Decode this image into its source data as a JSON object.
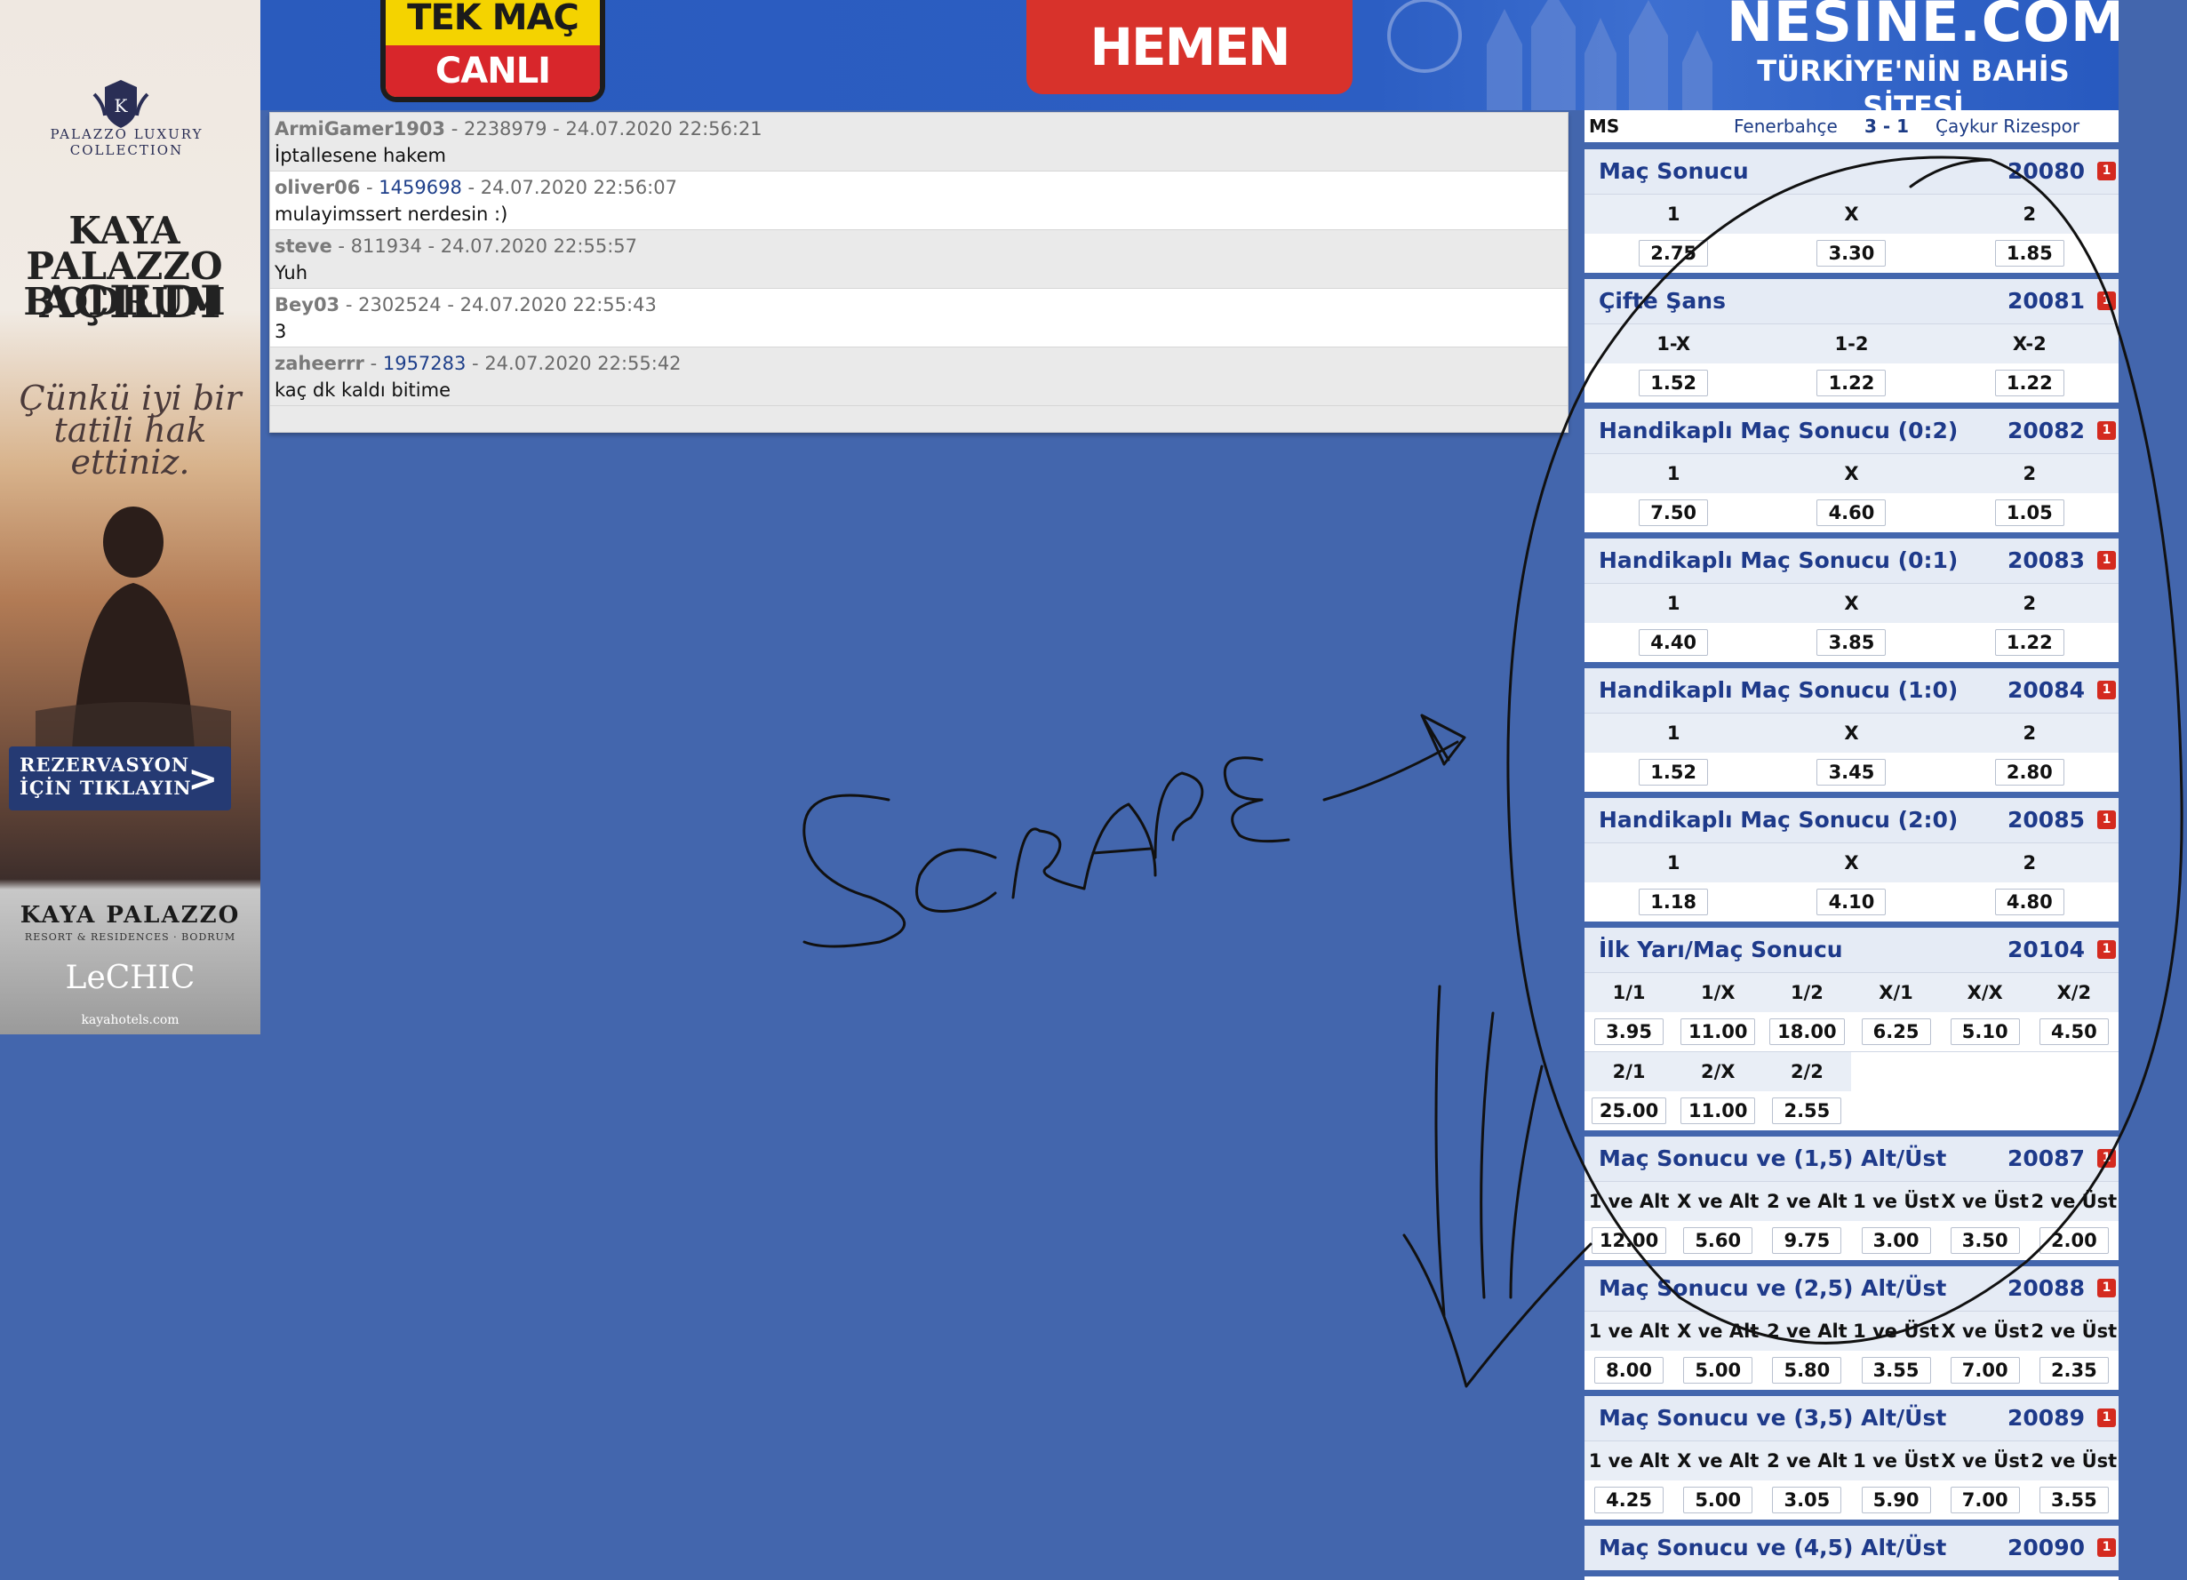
{
  "banner": {
    "tekmac_top": "TEK MAÇ",
    "tekmac_bottom": "CANLI İDDAA",
    "cta": "HEMEN OYNA",
    "site_name": "NESINE.COM",
    "site_tagline": "TÜRKİYE'NİN BAHİS SİTESİ"
  },
  "left_ad": {
    "collection": "PALAZZO LUXURY COLLECTION",
    "title_line1": "KAYA PALAZZO BODRUM",
    "title_line2": "AÇILDI",
    "slogan": "Çünkü iyi bir tatili hak ettiniz.",
    "cta": "REZERVASYON İÇİN TIKLAYIN",
    "cta_arrow": ">",
    "brand": "KAYA PALAZZO",
    "brand_sub": "RESORT & RESIDENCES · BODRUM",
    "lechic": "LeCHIC",
    "site": "kayahotels.com"
  },
  "comments": [
    {
      "user": "ArmiGamer1903",
      "id": "2238979",
      "id_link": false,
      "time": "24.07.2020 22:56:21",
      "text": "İptallesene hakem"
    },
    {
      "user": "oliver06",
      "id": "1459698",
      "id_link": true,
      "time": "24.07.2020 22:56:07",
      "text": "mulayimssert nerdesin :)"
    },
    {
      "user": "steve",
      "id": "811934",
      "id_link": false,
      "time": "24.07.2020 22:55:57",
      "text": "Yuh"
    },
    {
      "user": "Bey03",
      "id": "2302524",
      "id_link": false,
      "time": "24.07.2020 22:55:43",
      "text": "3"
    },
    {
      "user": "zaheerrr",
      "id": "1957283",
      "id_link": true,
      "time": "24.07.2020 22:55:42",
      "text": "kaç dk kaldı bitime"
    }
  ],
  "match": {
    "ms": "MS",
    "home": "Fenerbahçe",
    "score": "3 - 1",
    "away": "Çaykur Rizespor"
  },
  "markets": [
    {
      "title": "Maç Sonucu",
      "code": "20080",
      "badge": "1",
      "cols": 3,
      "rows": [
        {
          "labels": [
            "1",
            "X",
            "2"
          ],
          "odds": [
            "2.75",
            "3.30",
            "1.85"
          ]
        }
      ]
    },
    {
      "title": "Çifte Şans",
      "code": "20081",
      "badge": "1",
      "cols": 3,
      "rows": [
        {
          "labels": [
            "1-X",
            "1-2",
            "X-2"
          ],
          "odds": [
            "1.52",
            "1.22",
            "1.22"
          ]
        }
      ]
    },
    {
      "title": "Handikaplı Maç Sonucu (0:2)",
      "code": "20082",
      "badge": "1",
      "cols": 3,
      "rows": [
        {
          "labels": [
            "1",
            "X",
            "2"
          ],
          "odds": [
            "7.50",
            "4.60",
            "1.05"
          ]
        }
      ]
    },
    {
      "title": "Handikaplı Maç Sonucu (0:1)",
      "code": "20083",
      "badge": "1",
      "cols": 3,
      "rows": [
        {
          "labels": [
            "1",
            "X",
            "2"
          ],
          "odds": [
            "4.40",
            "3.85",
            "1.22"
          ]
        }
      ]
    },
    {
      "title": "Handikaplı Maç Sonucu (1:0)",
      "code": "20084",
      "badge": "1",
      "cols": 3,
      "rows": [
        {
          "labels": [
            "1",
            "X",
            "2"
          ],
          "odds": [
            "1.52",
            "3.45",
            "2.80"
          ]
        }
      ]
    },
    {
      "title": "Handikaplı Maç Sonucu (2:0)",
      "code": "20085",
      "badge": "1",
      "cols": 3,
      "rows": [
        {
          "labels": [
            "1",
            "X",
            "2"
          ],
          "odds": [
            "1.18",
            "4.10",
            "4.80"
          ]
        }
      ]
    },
    {
      "title": "İlk Yarı/Maç Sonucu",
      "code": "20104",
      "badge": "1",
      "cols": 6,
      "rows": [
        {
          "labels": [
            "1/1",
            "1/X",
            "1/2",
            "X/1",
            "X/X",
            "X/2"
          ],
          "odds": [
            "3.95",
            "11.00",
            "18.00",
            "6.25",
            "5.10",
            "4.50"
          ]
        },
        {
          "labels": [
            "2/1",
            "2/X",
            "2/2"
          ],
          "odds": [
            "25.00",
            "11.00",
            "2.55"
          ]
        }
      ]
    },
    {
      "title": "Maç Sonucu ve (1,5) Alt/Üst",
      "code": "20087",
      "badge": "1",
      "cols": 6,
      "rows": [
        {
          "labels": [
            "1 ve Alt",
            "X ve Alt",
            "2 ve Alt",
            "1 ve Üst",
            "X ve Üst",
            "2 ve Üst"
          ],
          "odds": [
            "12.00",
            "5.60",
            "9.75",
            "3.00",
            "3.50",
            "2.00"
          ]
        }
      ]
    },
    {
      "title": "Maç Sonucu ve (2,5) Alt/Üst",
      "code": "20088",
      "badge": "1",
      "cols": 6,
      "rows": [
        {
          "labels": [
            "1 ve Alt",
            "X ve Alt",
            "2 ve Alt",
            "1 ve Üst",
            "X ve Üst",
            "2 ve Üst"
          ],
          "odds": [
            "8.00",
            "5.00",
            "5.80",
            "3.55",
            "7.00",
            "2.35"
          ]
        }
      ]
    },
    {
      "title": "Maç Sonucu ve (3,5) Alt/Üst",
      "code": "20089",
      "badge": "1",
      "cols": 6,
      "rows": [
        {
          "labels": [
            "1 ve Alt",
            "X ve Alt",
            "2 ve Alt",
            "1 ve Üst",
            "X ve Üst",
            "2 ve Üst"
          ],
          "odds": [
            "4.25",
            "5.00",
            "3.05",
            "5.90",
            "7.00",
            "3.55"
          ]
        }
      ]
    },
    {
      "title": "Maç Sonucu ve (4,5) Alt/Üst",
      "code": "20090",
      "badge": "1",
      "cols": 6,
      "rows": []
    }
  ],
  "annotation": {
    "text": "SCRAPE",
    "ink_color": "#111111"
  },
  "colors": {
    "page_bg": "#4366ad",
    "market_title": "#1e3a8a",
    "badge_red": "#d42a1f",
    "banner_blue": "#2a5bbd",
    "cta_red": "#d8322b",
    "tekmac_yellow": "#f4d300"
  }
}
